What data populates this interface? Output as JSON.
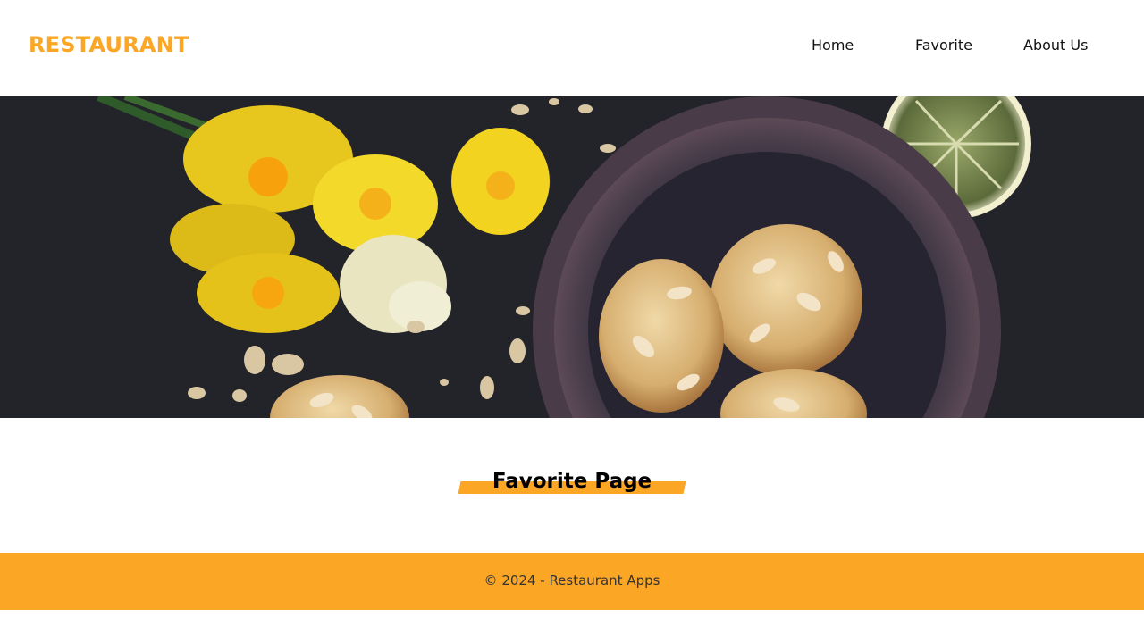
{
  "header": {
    "brand": "RESTAURANT",
    "nav": {
      "home": "Home",
      "favorite": "Favorite",
      "about": "About Us"
    }
  },
  "hero": {
    "image_icon": "hero-food-image"
  },
  "main": {
    "title": "Favorite Page"
  },
  "footer": {
    "text": "© 2024 - Restaurant Apps"
  },
  "colors": {
    "accent": "#fca626",
    "hero_bg": "#23232a",
    "text": "#111111"
  }
}
